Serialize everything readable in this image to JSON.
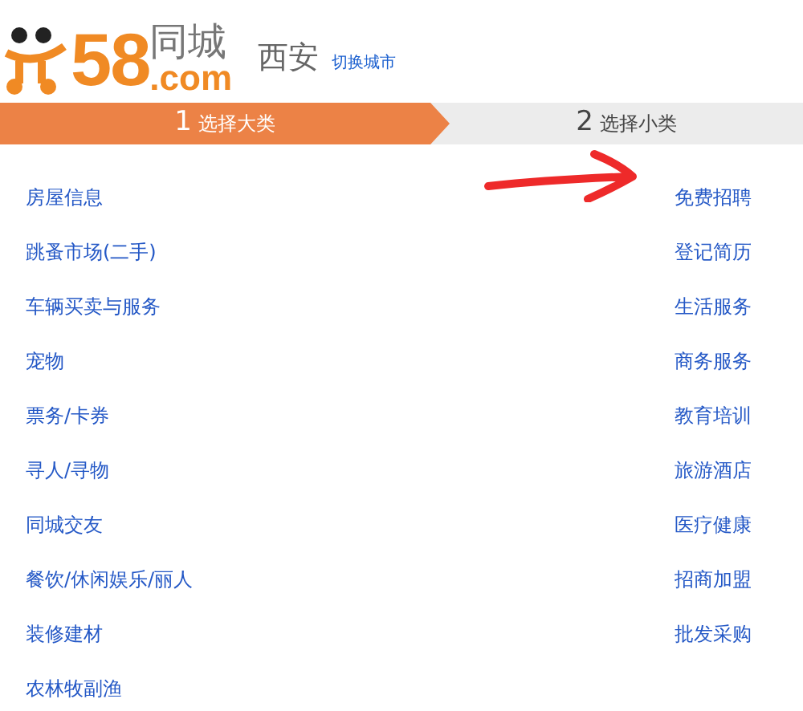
{
  "logo": {
    "number": "58",
    "domain": ".com",
    "name": "同城"
  },
  "city": {
    "name": "西安",
    "switch_link": "切换城市"
  },
  "steps": [
    {
      "number": "1",
      "label": "选择大类",
      "selected": true
    },
    {
      "number": "2",
      "label": "选择小类",
      "selected": false
    }
  ],
  "categories_left": [
    "房屋信息",
    "跳蚤市场(二手)",
    "车辆买卖与服务",
    "宠物",
    "票务/卡券",
    "寻人/寻物",
    "同城交友",
    "餐饮/休闲娱乐/丽人",
    "装修建材",
    "农林牧副渔"
  ],
  "categories_right": [
    "免费招聘",
    "登记简历",
    "生活服务",
    "商务服务",
    "教育培训",
    "旅游酒店",
    "医疗健康",
    "招商加盟",
    "批发采购"
  ]
}
